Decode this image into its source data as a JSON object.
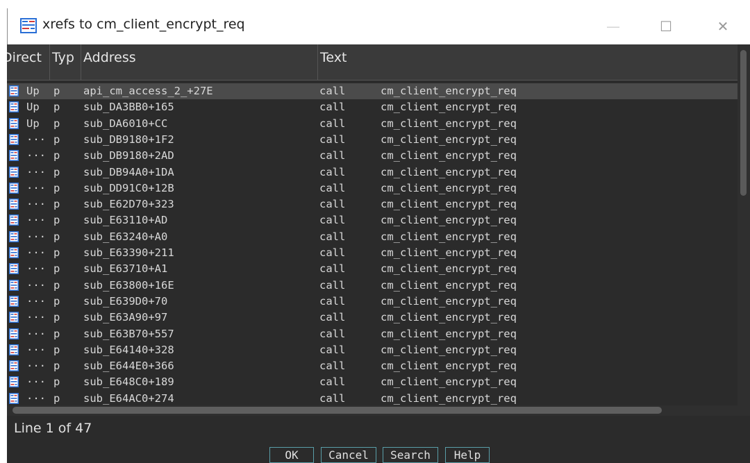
{
  "window": {
    "title": "xrefs to cm_client_encrypt_req",
    "icon": "xref-window-icon",
    "controls": {
      "minimize": "—",
      "maximize": "☐",
      "close": "✕"
    }
  },
  "table": {
    "columns": {
      "direction": "Direct",
      "type": "Typ",
      "address": "Address",
      "text": "Text"
    },
    "row_icon": "xref-row-icon",
    "rows": [
      {
        "direction": "Up",
        "type": "p",
        "address": "api_cm_access_2_+27E",
        "kind": "call",
        "text": "cm_client_encrypt_req"
      },
      {
        "direction": "Up",
        "type": "p",
        "address": "sub_DA3BB0+165",
        "kind": "call",
        "text": "cm_client_encrypt_req"
      },
      {
        "direction": "Up",
        "type": "p",
        "address": "sub_DA6010+CC",
        "kind": "call",
        "text": "cm_client_encrypt_req"
      },
      {
        "direction": "···",
        "type": "p",
        "address": "sub_DB9180+1F2",
        "kind": "call",
        "text": "cm_client_encrypt_req"
      },
      {
        "direction": "···",
        "type": "p",
        "address": "sub_DB9180+2AD",
        "kind": "call",
        "text": "cm_client_encrypt_req"
      },
      {
        "direction": "···",
        "type": "p",
        "address": "sub_DB94A0+1DA",
        "kind": "call",
        "text": "cm_client_encrypt_req"
      },
      {
        "direction": "···",
        "type": "p",
        "address": "sub_DD91C0+12B",
        "kind": "call",
        "text": "cm_client_encrypt_req"
      },
      {
        "direction": "···",
        "type": "p",
        "address": "sub_E62D70+323",
        "kind": "call",
        "text": "cm_client_encrypt_req"
      },
      {
        "direction": "···",
        "type": "p",
        "address": "sub_E63110+AD",
        "kind": "call",
        "text": "cm_client_encrypt_req"
      },
      {
        "direction": "···",
        "type": "p",
        "address": "sub_E63240+A0",
        "kind": "call",
        "text": "cm_client_encrypt_req"
      },
      {
        "direction": "···",
        "type": "p",
        "address": "sub_E63390+211",
        "kind": "call",
        "text": "cm_client_encrypt_req"
      },
      {
        "direction": "···",
        "type": "p",
        "address": "sub_E63710+A1",
        "kind": "call",
        "text": "cm_client_encrypt_req"
      },
      {
        "direction": "···",
        "type": "p",
        "address": "sub_E63800+16E",
        "kind": "call",
        "text": "cm_client_encrypt_req"
      },
      {
        "direction": "···",
        "type": "p",
        "address": "sub_E639D0+70",
        "kind": "call",
        "text": "cm_client_encrypt_req"
      },
      {
        "direction": "···",
        "type": "p",
        "address": "sub_E63A90+97",
        "kind": "call",
        "text": "cm_client_encrypt_req"
      },
      {
        "direction": "···",
        "type": "p",
        "address": "sub_E63B70+557",
        "kind": "call",
        "text": "cm_client_encrypt_req"
      },
      {
        "direction": "···",
        "type": "p",
        "address": "sub_E64140+328",
        "kind": "call",
        "text": "cm_client_encrypt_req"
      },
      {
        "direction": "···",
        "type": "p",
        "address": "sub_E644E0+366",
        "kind": "call",
        "text": "cm_client_encrypt_req"
      },
      {
        "direction": "···",
        "type": "p",
        "address": "sub_E648C0+189",
        "kind": "call",
        "text": "cm_client_encrypt_req"
      },
      {
        "direction": "···",
        "type": "p",
        "address": "sub_E64AC0+274",
        "kind": "call",
        "text": "cm_client_encrypt_req"
      }
    ],
    "selected_row": 0
  },
  "status": {
    "line_info": "Line 1 of 47"
  },
  "buttons": {
    "ok": "OK",
    "cancel": "Cancel",
    "search": "Search",
    "help": "Help"
  },
  "colors": {
    "background": "#2b2b2b",
    "header": "#3a3a3a",
    "selection": "#4b4b4b",
    "button_border": "#5a9ea8",
    "icon_blue": "#2a6fd6"
  }
}
